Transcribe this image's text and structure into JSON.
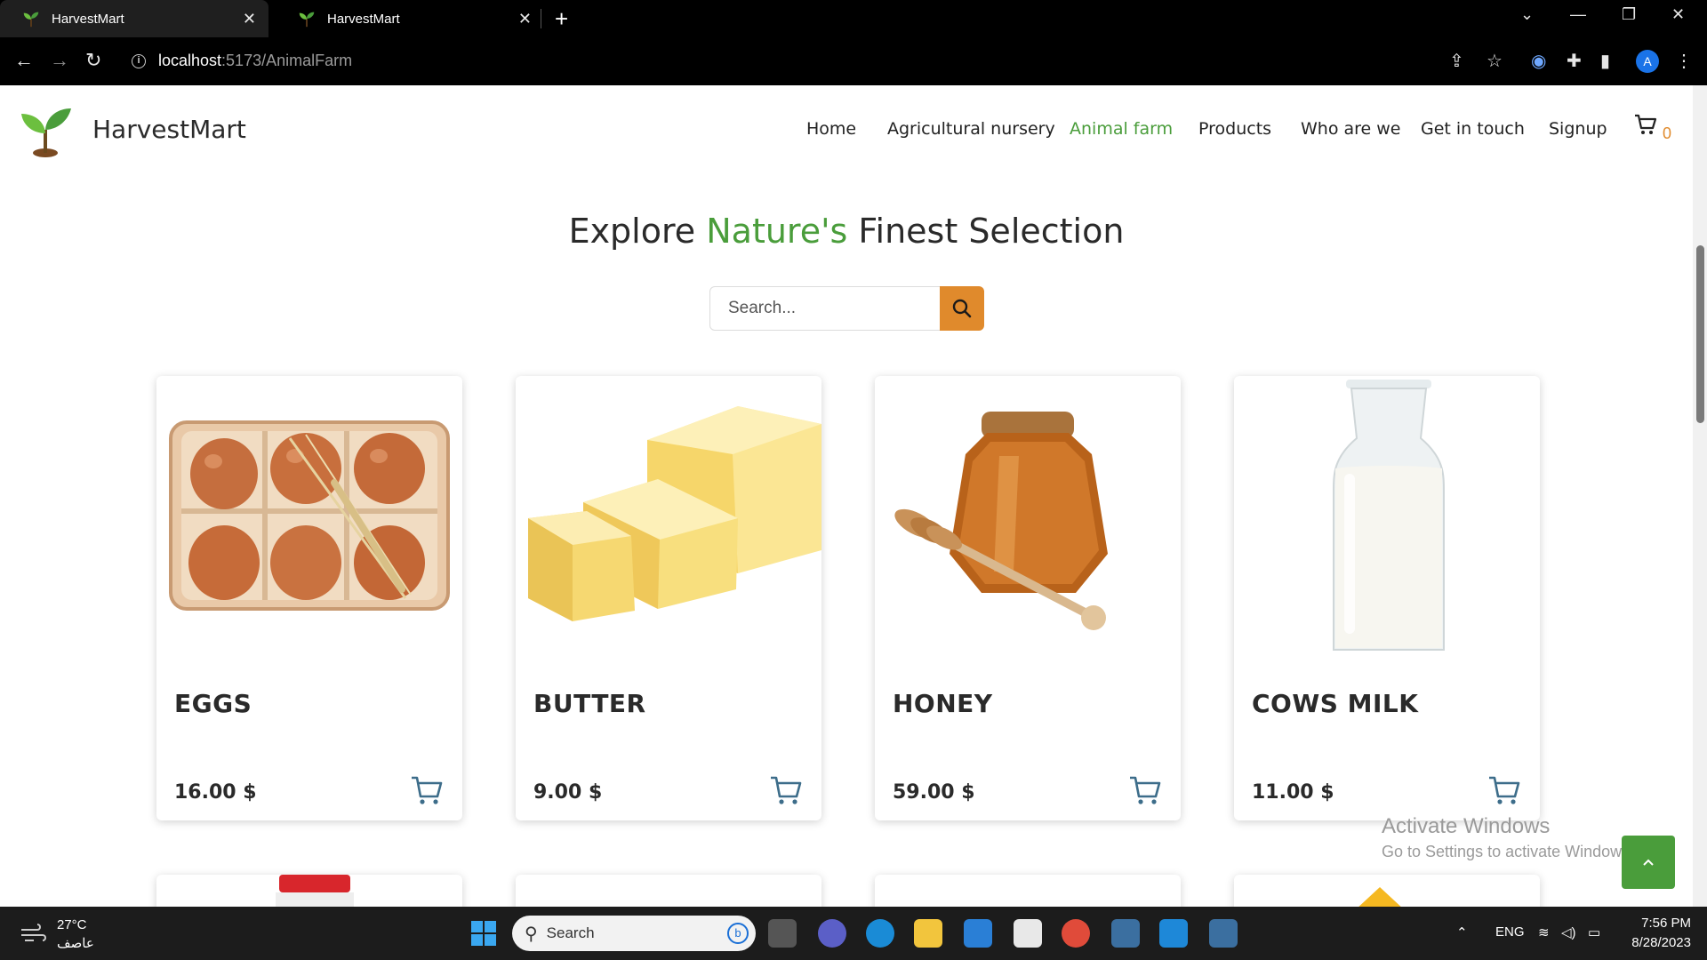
{
  "browser": {
    "tabs": [
      {
        "title": "HarvestMart",
        "active": true
      },
      {
        "title": "HarvestMart",
        "active": false
      }
    ],
    "url_host": "localhost",
    "url_path": ":5173/AnimalFarm",
    "profile_initial": "A"
  },
  "site": {
    "brand": "HarvestMart",
    "nav": [
      {
        "label": "Home",
        "active": false
      },
      {
        "label": "Agricultural nursery",
        "active": false
      },
      {
        "label": "Animal farm",
        "active": true
      },
      {
        "label": "Products",
        "active": false
      },
      {
        "label": "Who are we",
        "active": false
      },
      {
        "label": "Get in touch",
        "active": false
      },
      {
        "label": "Signup",
        "active": false
      }
    ],
    "cart_count": "0",
    "accent_green": "#4a9d3b",
    "accent_orange": "#e08a2c"
  },
  "hero": {
    "title_part1": "Explore ",
    "title_highlight": "Nature's",
    "title_part2": " Finest Selection"
  },
  "search": {
    "placeholder": "Search...",
    "value": ""
  },
  "products": [
    {
      "name": "EGGS",
      "price": "16.00 $",
      "image": "eggs-image"
    },
    {
      "name": "BUTTER",
      "price": "9.00 $",
      "image": "butter-image"
    },
    {
      "name": "HONEY",
      "price": "59.00 $",
      "image": "honey-image"
    },
    {
      "name": "COWS MILK",
      "price": "11.00 $",
      "image": "milk-image"
    }
  ],
  "watermark": {
    "line1": "Activate Windows",
    "line2": "Go to Settings to activate Windows."
  },
  "taskbar": {
    "temperature": "27°C",
    "weather_desc": "عاصف",
    "search_label": "Search",
    "language": "ENG",
    "time": "7:56 PM",
    "date": "8/28/2023"
  }
}
